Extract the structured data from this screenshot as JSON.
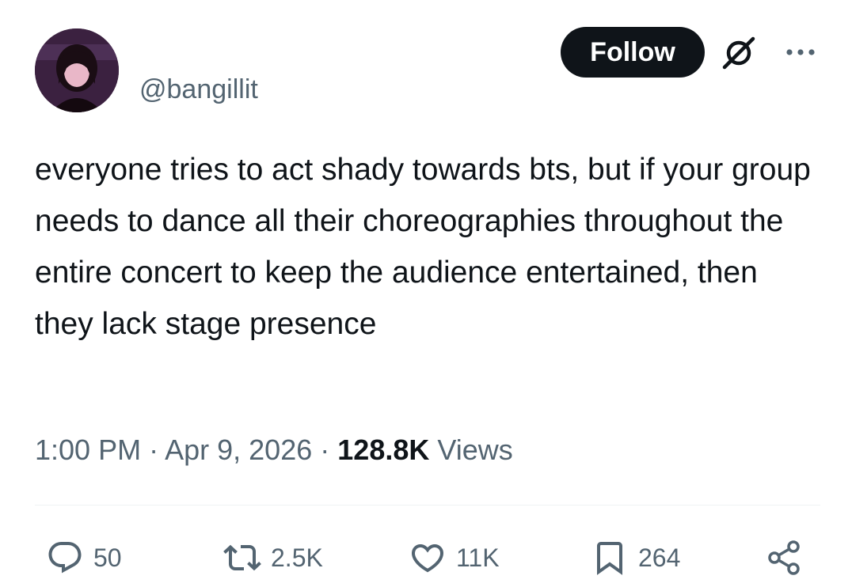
{
  "author": {
    "handle": "@bangillit"
  },
  "header": {
    "follow_label": "Follow"
  },
  "tweet": {
    "text": "everyone tries to act shady towards bts, but if your group needs to dance all their choreographies throughout the entire concert to keep the audience entertained, then they lack stage presence",
    "time": "1:00 PM",
    "separator": "·",
    "date": "Apr 9, 2026",
    "views_count": "128.8K",
    "views_label": "Views"
  },
  "actions": {
    "replies": "50",
    "reposts": "2.5K",
    "likes": "11K",
    "bookmarks": "264"
  },
  "icons": {
    "reply": "speech-bubble-icon",
    "repost": "repost-arrows-icon",
    "like": "heart-icon",
    "bookmark": "bookmark-icon",
    "share": "share-nodes-icon",
    "grok": "grok-slash-circle-icon",
    "more": "more-dots-icon"
  },
  "colors": {
    "text_primary": "#0f1419",
    "text_secondary": "#536471",
    "follow_button_bg": "#0f1419",
    "divider": "#eff3f4"
  }
}
